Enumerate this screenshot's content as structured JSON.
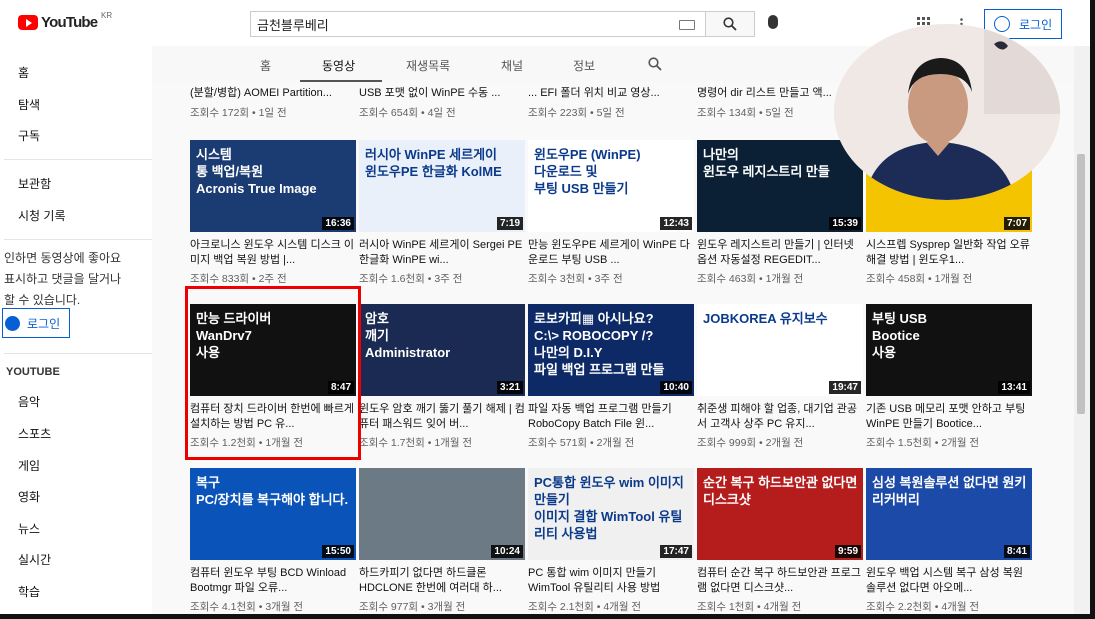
{
  "header": {
    "logo_text": "YouTube",
    "region": "KR",
    "search_value": "금천블루베리",
    "login_label": "로그인"
  },
  "sidebar": {
    "items": [
      "홈",
      "탐색",
      "구독",
      "보관함",
      "시청 기록",
      "음악",
      "스포츠",
      "게임",
      "영화",
      "뉴스",
      "실시간",
      "학습"
    ],
    "message": "로그인하면 동영상에 좋아요 표시하고 댓글을 달거나 구독할 수 있습니다.",
    "message_visible": "인하면 동영상에 좋아요\n표시하고 댓글을 달거나\n할 수 있습니다.",
    "login_label": "로그인",
    "section_title": "YOUTUBE"
  },
  "tabs": [
    {
      "label": "홈"
    },
    {
      "label": "동영상",
      "active": true
    },
    {
      "label": "재생목록"
    },
    {
      "label": "채널"
    },
    {
      "label": "정보"
    }
  ],
  "partial_row": [
    {
      "title": "(분할/병합) AOMEI Partition...",
      "meta": "조회수 172회 • 1일 전"
    },
    {
      "title": "USB 포맷 없이 WinPE 수동 ...",
      "meta": "조회수 654회 • 4일 전"
    },
    {
      "title": "... EFI 폴더 위치 비교 영상...",
      "meta": "조회수 223회 • 5일 전"
    },
    {
      "title": "명령어 dir 리스트 만들고 액...",
      "meta": "조회수 134회 • 5일 전"
    },
    {
      "title": "",
      "meta": ""
    }
  ],
  "rows": [
    [
      {
        "thumb_text": "시스템\n통 백업/복원\nAcronis True Image",
        "duration": "16:36",
        "title": "아크로니스 윈도우 시스템 디스크 이미지 백업 복원 방법 |...",
        "meta": "조회수 833회 • 2주 전",
        "bg": "#1b3c73"
      },
      {
        "thumb_text": "러시아 WinPE 세르게이\n윈도우PE 한글화 KolME",
        "duration": "7:19",
        "title": "러시아 WinPE 세르게이 Sergei PE 한글화 WinPE wi...",
        "meta": "조회수 1.6천회 • 3주 전",
        "bg": "#eaf0fa"
      },
      {
        "thumb_text": "윈도우PE (WinPE)\n다운로드 및\n부팅 USB 만들기",
        "duration": "12:43",
        "title": "만능 윈도우PE 세르게이 WinPE 다운로드 부팅 USB ...",
        "meta": "조회수 3천회 • 3주 전",
        "bg": "#ffffff"
      },
      {
        "thumb_text": "나만의\n윈도우 레지스트리 만들",
        "duration": "15:39",
        "title": "윈도우 레지스트리 만들기 | 인터넷옵션 자동설정 REGEDIT...",
        "meta": "조회수 463회 • 1개월 전",
        "bg": "#0b2035"
      },
      {
        "thumb_text": "",
        "duration": "7:07",
        "title": "시스프렙 Sysprep 일반화 작업 오류 해결 방법 | 윈도우1...",
        "meta": "조회수 458회 • 1개월 전",
        "bg": "#f5c400"
      }
    ],
    [
      {
        "thumb_text": "만능 드라이버\nWanDrv7\n사용",
        "duration": "8:47",
        "title": "컴퓨터 장치 드라이버 한번에 빠르게 설치하는 방법 PC 유...",
        "meta": "조회수 1.2천회 • 1개월 전",
        "bg": "#111111"
      },
      {
        "thumb_text": "암호\n깨기\nAdministrator",
        "duration": "3:21",
        "title": "윈도우 암호 깨기 뚫기 풀기 해제 | 컴퓨터 패스워드 잊어 버...",
        "meta": "조회수 1.7천회 • 1개월 전",
        "bg": "#1b2a52"
      },
      {
        "thumb_text": "로보카피▦ 아시나요?\nC:\\> ROBOCOPY /?\n나만의 D.I.Y\n파일 백업 프로그램 만들",
        "duration": "10:40",
        "title": "파일 자동 백업 프로그램 만들기 RoboCopy Batch File 윈...",
        "meta": "조회수 571회 • 2개월 전",
        "bg": "#0d2a66"
      },
      {
        "thumb_text": "JOBKOREA 유지보수",
        "duration": "19:47",
        "title": "취준생 피해야 할 업종, 대기업 관공서 고객사 상주 PC 유지...",
        "meta": "조회수 999회 • 2개월 전",
        "bg": "#ffffff"
      },
      {
        "thumb_text": "부팅 USB\nBootice\n사용",
        "duration": "13:41",
        "title": "기존 USB 메모리 포맷 안하고 부팅 WinPE 만들기 Bootice...",
        "meta": "조회수 1.5천회 • 2개월 전",
        "bg": "#111111"
      }
    ],
    [
      {
        "thumb_text": "복구\nPC/장치를 복구해야 합니다.",
        "duration": "15:50",
        "title": "컴퓨터 윈도우 부팅 BCD Winload Bootmgr 파일 오류...",
        "meta": "조회수 4.1천회 • 3개월 전",
        "bg": "#0a53b8"
      },
      {
        "thumb_text": "",
        "duration": "10:24",
        "title": "하드카피기 없다면 하드클론 HDCLONE 한번에 여러대 하...",
        "meta": "조회수 977회 • 3개월 전",
        "bg": "#6b7a84"
      },
      {
        "thumb_text": "PC통합 윈도우 wim 이미지 만들기\n이미지 결합 WimTool 유틸리티 사용법",
        "duration": "17:47",
        "title": "PC 통합 wim 이미지 만들기 WimTool 유틸리티 사용 방법",
        "meta": "조회수 2.1천회 • 4개월 전",
        "bg": "#f0f0f0"
      },
      {
        "thumb_text": "순간 복구 하드보안관 없다면 디스크샷",
        "duration": "9:59",
        "title": "컴퓨터 순간 복구 하드보안관 프로그램 없다면 디스크샷...",
        "meta": "조회수 1천회 • 4개월 전",
        "bg": "#b51c1c"
      },
      {
        "thumb_text": "심성 복원솔루션 없다면 원키 리커버리",
        "duration": "8:41",
        "title": "윈도우 백업 시스템 복구 삼성 복원 솔루션 없다면 아오메...",
        "meta": "조회수 2.2천회 • 4개월 전",
        "bg": "#1c4aa8"
      }
    ]
  ],
  "colors": {
    "accent": "#065fd4",
    "highlight": "#e00000",
    "brand": "#ff0000"
  }
}
